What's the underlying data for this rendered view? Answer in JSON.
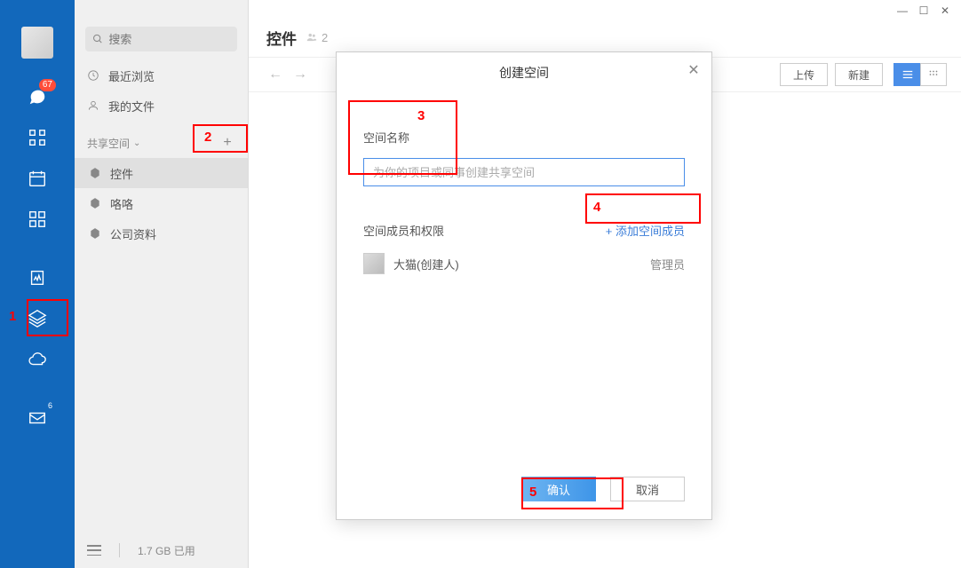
{
  "rail": {
    "chat_badge": "67",
    "mail_badge": "6"
  },
  "sidebar": {
    "search_placeholder": "搜索",
    "nav": [
      {
        "label": "最近浏览"
      },
      {
        "label": "我的文件"
      }
    ],
    "section_label": "共享空间",
    "spaces": [
      {
        "label": "控件",
        "active": true
      },
      {
        "label": "咯咯",
        "active": false
      },
      {
        "label": "公司资料",
        "active": false
      }
    ],
    "storage": "1.7 GB 已用"
  },
  "header": {
    "title": "控件",
    "people_count": "2"
  },
  "toolbar": {
    "upload": "上传",
    "create": "新建"
  },
  "modal": {
    "title": "创建空间",
    "field_label": "空间名称",
    "field_placeholder": "为你的项目或同事创建共享空间",
    "members_label": "空间成员和权限",
    "add_member": "+ 添加空间成员",
    "member_name": "大猫(创建人)",
    "member_role": "管理员",
    "confirm": "确认",
    "cancel": "取消"
  },
  "callouts": {
    "c1": "1",
    "c2": "2",
    "c3": "3",
    "c4": "4",
    "c5": "5"
  }
}
